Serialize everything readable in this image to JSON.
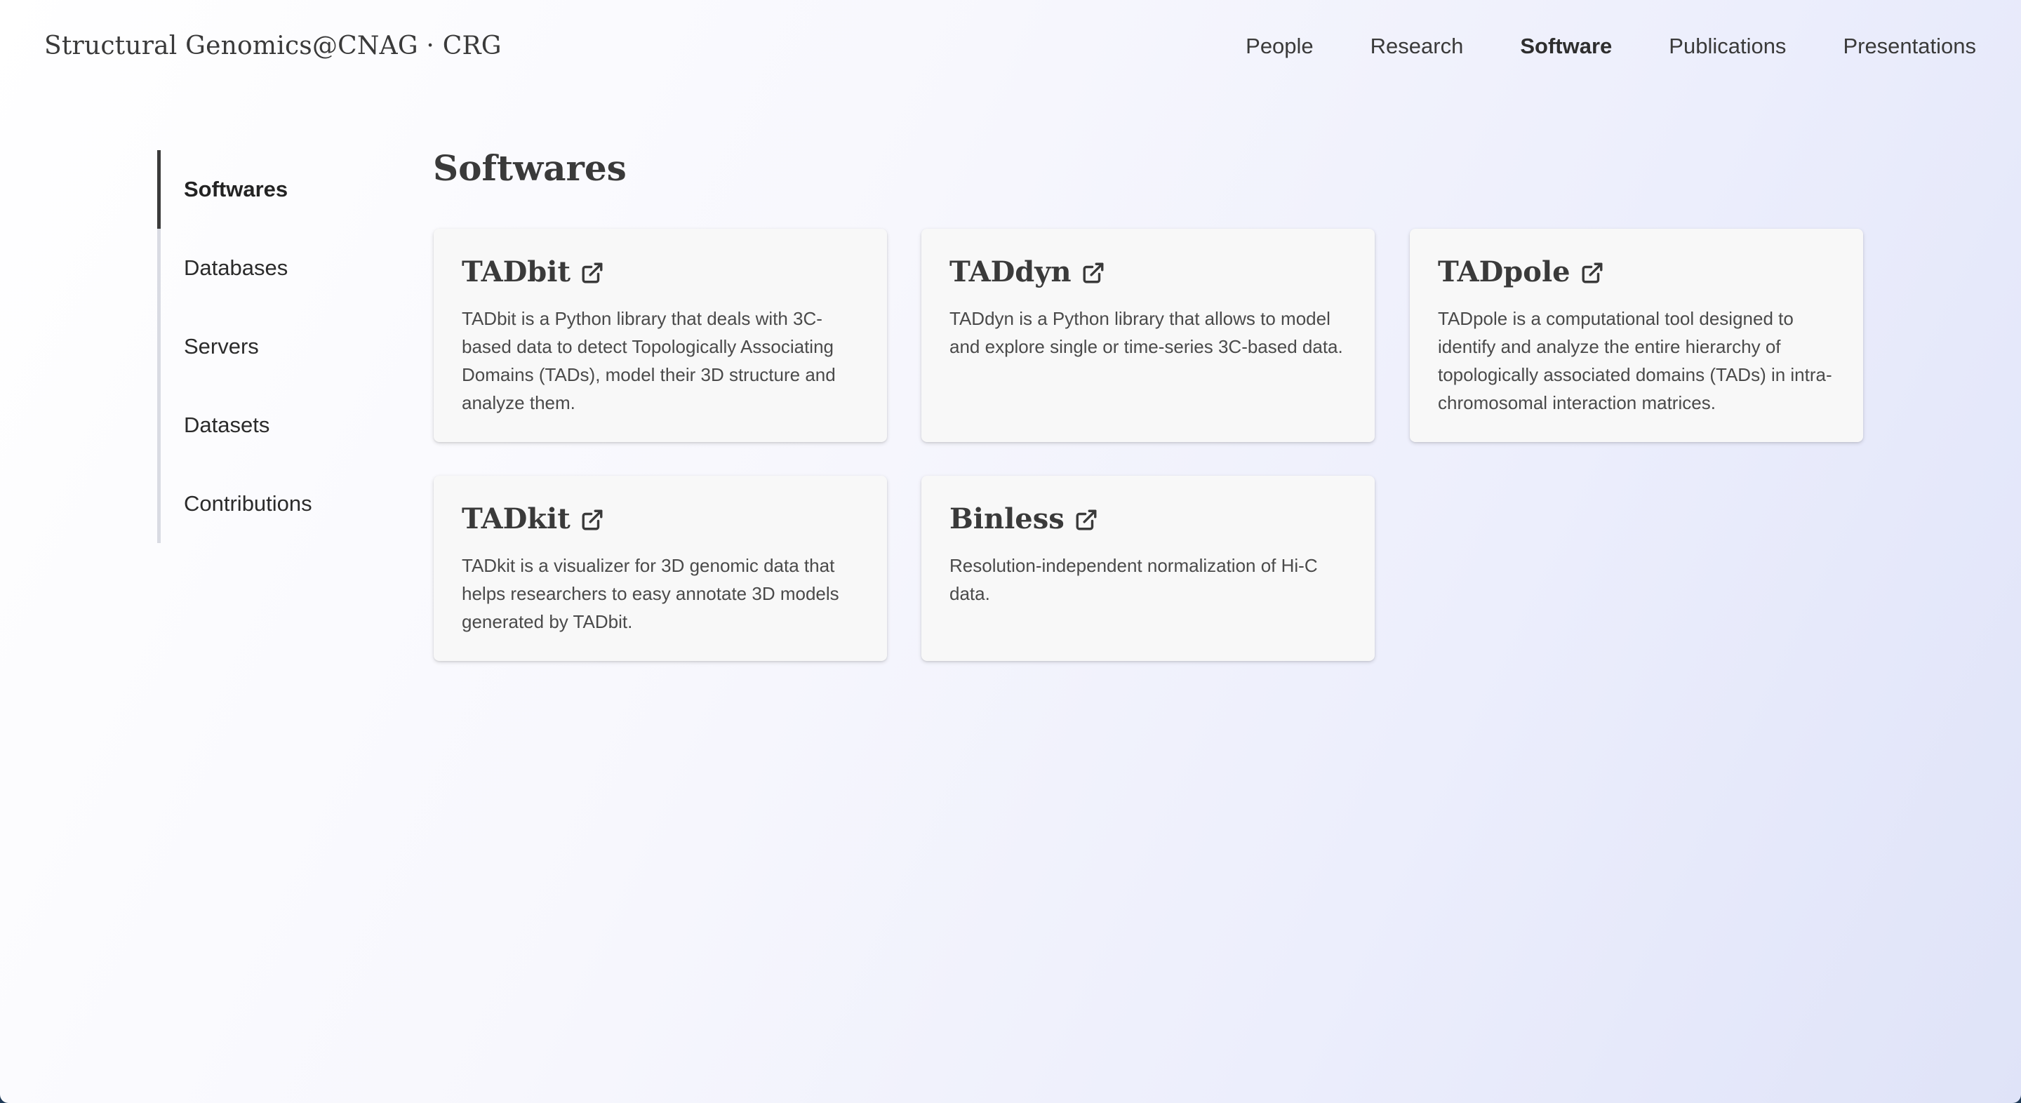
{
  "header": {
    "site_title": "Structural Genomics@CNAG · CRG",
    "nav": [
      {
        "label": "People"
      },
      {
        "label": "Research"
      },
      {
        "label": "Software",
        "active": true
      },
      {
        "label": "Publications"
      },
      {
        "label": "Presentations"
      }
    ]
  },
  "sidebar": {
    "items": [
      {
        "label": "Softwares",
        "active": true
      },
      {
        "label": "Databases"
      },
      {
        "label": "Servers"
      },
      {
        "label": "Datasets"
      },
      {
        "label": "Contributions"
      }
    ]
  },
  "main": {
    "title": "Softwares",
    "cards": [
      {
        "title": "TADbit",
        "icon": "external-link-icon",
        "description": "TADbit is a Python library that deals with 3C-based data to detect Topologically Associating Domains (TADs), model their 3D structure and analyze them."
      },
      {
        "title": "TADdyn",
        "icon": "external-link-icon",
        "description": "TADdyn is a Python library that allows to model and explore single or time-series 3C-based data."
      },
      {
        "title": "TADpole",
        "icon": "external-link-icon",
        "description": "TADpole is a computational tool designed to identify and analyze the entire hierarchy of topologically associated domains (TADs) in intra-chromosomal interaction matrices."
      },
      {
        "title": "TADkit",
        "icon": "external-link-icon",
        "description": "TADkit is a visualizer for 3D genomic data that helps researchers to easy annotate 3D models generated by TADbit."
      },
      {
        "title": "Binless",
        "icon": "external-link-icon",
        "description": "Resolution-independent normalization of Hi-C data."
      }
    ]
  },
  "colors": {
    "text": "#3a3a3a",
    "sidebar_active_bar": "#3b3b3b",
    "sidebar_rail": "#d9dbe3",
    "card_bg": "#f8f8f8"
  }
}
